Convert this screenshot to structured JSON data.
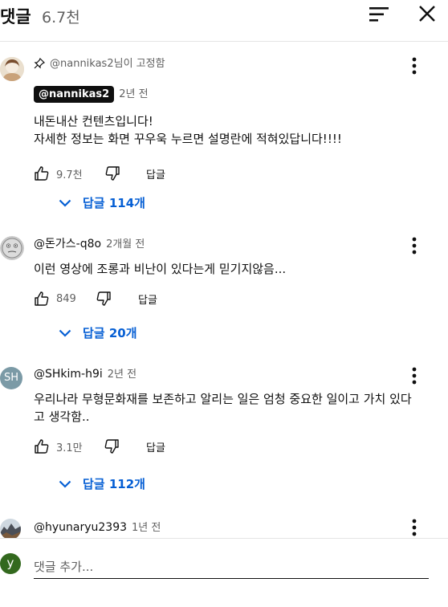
{
  "header": {
    "title": "댓글",
    "count": "6.7천"
  },
  "comments": [
    {
      "pinned_by": "@nannikas2님이 고정함",
      "author": "@nannikas2",
      "time": "2년 전",
      "text": "내돈내산 컨텐츠입니다!\n자세한 정보는 화면 꾸우욱 누르면 설명란에 적혀있답니다!!!!",
      "likes": "9.7천",
      "reply_label": "답글",
      "replies": "답글 114개"
    },
    {
      "author": "@돈가스-q8o",
      "time": "2개월 전",
      "text": "이런 영상에 조롱과 비난이 있다는게 믿기지않음...",
      "likes": "849",
      "reply_label": "답글",
      "replies": "답글 20개"
    },
    {
      "author": "@SHkim-h9i",
      "avatar_initials": "SH",
      "time": "2년 전",
      "text": "우리나라 무형문화재를 보존하고 알리는 일은 엄청 중요한 일이고 가치 있다고 생각함..",
      "likes": "3.1만",
      "reply_label": "답글",
      "replies": "답글 112개"
    },
    {
      "author": "@hyunaryu2393",
      "time": "1년 전"
    }
  ],
  "composer": {
    "avatar_initial": "y",
    "placeholder": "댓글 추가..."
  },
  "colors": {
    "link": "#065fd4",
    "secondary_text": "#606060",
    "composer_avatar": "#33691e",
    "sh_avatar": "#7b9aa6"
  }
}
